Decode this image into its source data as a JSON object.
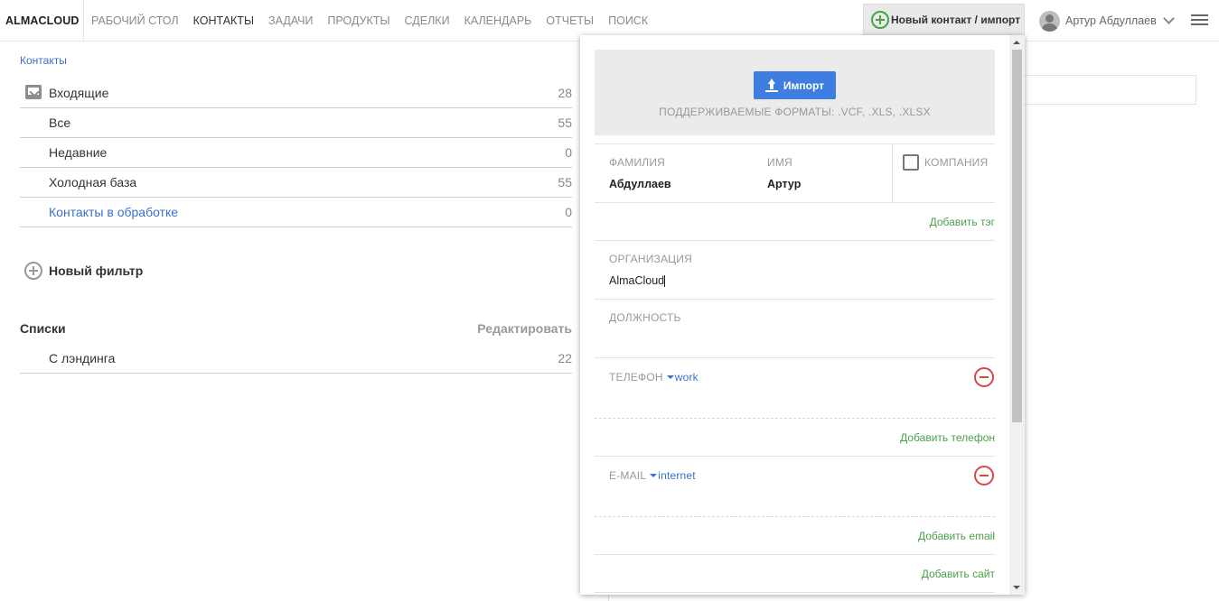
{
  "brand": "ALMACLOUD",
  "nav": [
    "РАБОЧИЙ СТОЛ",
    "КОНТАКТЫ",
    "ЗАДАЧИ",
    "ПРОДУКТЫ",
    "СДЕЛКИ",
    "КАЛЕНДАРЬ",
    "ОТЧЕТЫ",
    "ПОИСК"
  ],
  "nav_active": "КОНТАКТЫ",
  "new_contact_button": "Новый контакт / импорт",
  "user_name": "Артур Абдуллаев",
  "breadcrumb": "Контакты",
  "filters": [
    {
      "label": "Входящие",
      "count": "28"
    },
    {
      "label": "Все",
      "count": "55"
    },
    {
      "label": "Недавние",
      "count": "0"
    },
    {
      "label": "Холодная база",
      "count": "55"
    },
    {
      "label": "Контакты в обработке",
      "count": "0"
    }
  ],
  "new_filter": "Новый фильтр",
  "lists": {
    "title": "Списки",
    "edit": "Редактировать",
    "items": [
      {
        "label": "С лэндинга",
        "count": "22"
      }
    ]
  },
  "popup": {
    "import_button": "Импорт",
    "formats": "ПОДДЕРЖИВАЕМЫЕ ФОРМАТЫ: .VCF, .XLS, .XLSX",
    "last_name_label": "ФАМИЛИЯ",
    "last_name_value": "Абдуллаев",
    "first_name_label": "ИМЯ",
    "first_name_value": "Артур",
    "company_label": "КОМПАНИЯ",
    "add_tag": "Добавить тэг",
    "organization_label": "ОРГАНИЗАЦИЯ",
    "organization_value": "AlmaCloud",
    "position_label": "ДОЛЖНОСТЬ",
    "phone_label": "ТЕЛЕФОН",
    "phone_type": "work",
    "add_phone": "Добавить телефон",
    "email_label": "E-MAIL",
    "email_type": "internet",
    "add_email": "Добавить email",
    "add_site": "Добавить сайт"
  },
  "colors": {
    "accent_blue": "#3d7ee0",
    "link_blue": "#3b6fd1",
    "green": "#4aa04a",
    "remove_red": "#d9454a"
  },
  "icons": [
    "plus-circle-icon",
    "user-avatar-icon",
    "chevron-down-icon",
    "menu-icon",
    "inbox-icon",
    "upload-icon",
    "remove-circle-icon"
  ]
}
